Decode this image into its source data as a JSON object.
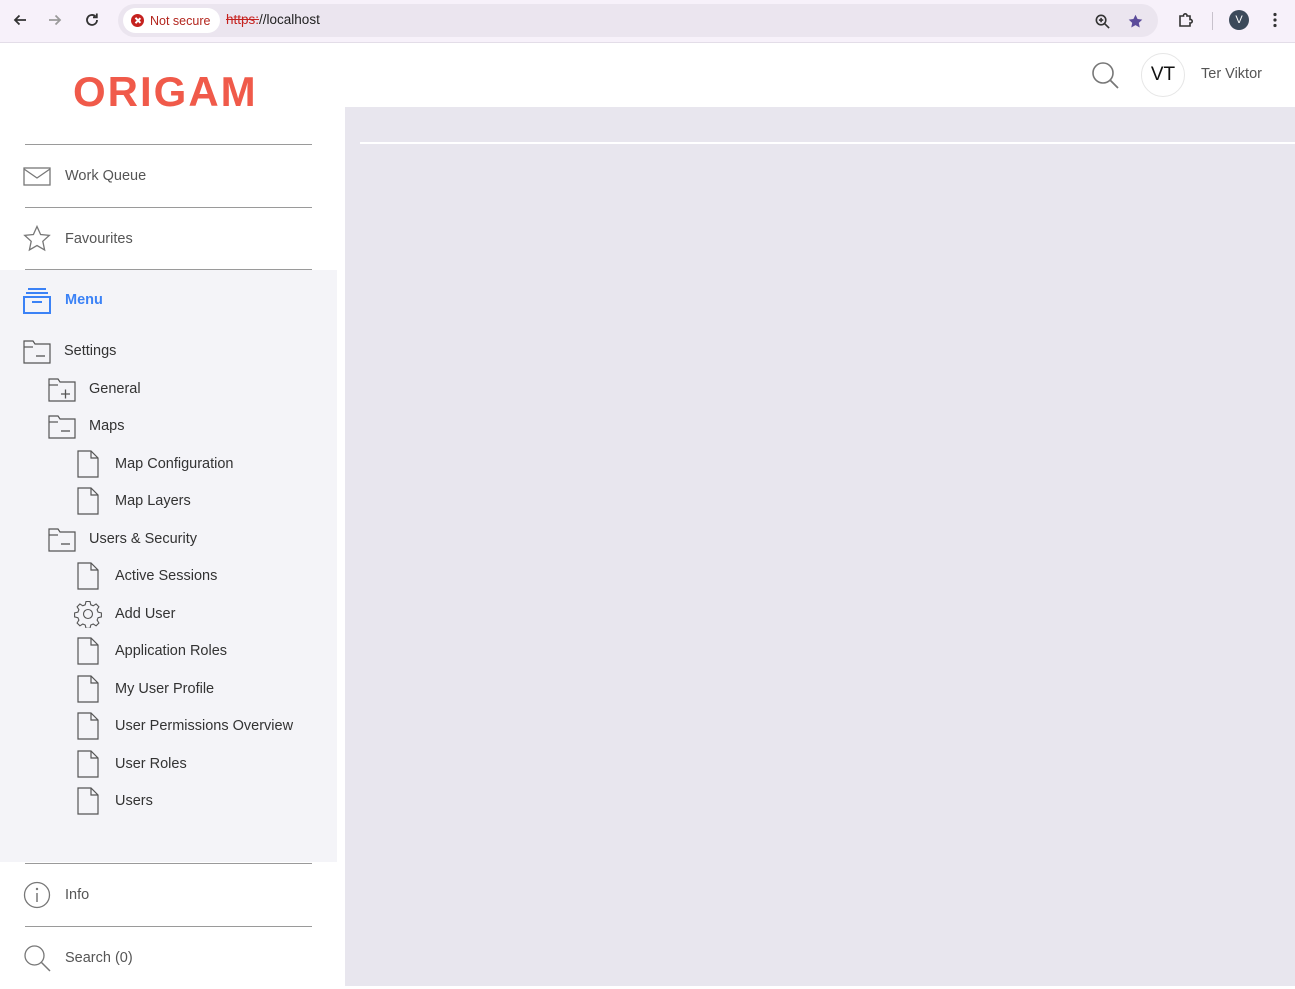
{
  "browser": {
    "security_label": "Not secure",
    "url_scheme": "https:",
    "url_rest": "//localhost",
    "profile_initial": "V"
  },
  "app": {
    "logo_text": "ORIGAM",
    "logo_color": "#f05a4a",
    "accent_color": "#3b82f6"
  },
  "header": {
    "user_initials": "VT",
    "user_name": "Ter Viktor"
  },
  "sidebar": {
    "work_queue": "Work Queue",
    "favourites": "Favourites",
    "menu": "Menu",
    "info": "Info",
    "search": "Search (0)"
  },
  "tree": {
    "settings": "Settings",
    "general": "General",
    "maps": "Maps",
    "map_configuration": "Map Configuration",
    "map_layers": "Map Layers",
    "users_security": "Users & Security",
    "active_sessions": "Active Sessions",
    "add_user": "Add User",
    "application_roles": "Application Roles",
    "my_user_profile": "My User Profile",
    "user_permissions_overview": "User Permissions Overview",
    "user_roles": "User Roles",
    "users": "Users"
  }
}
